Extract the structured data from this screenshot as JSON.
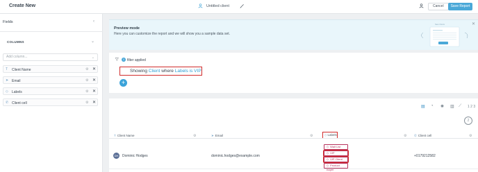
{
  "topbar": {
    "title": "Create New",
    "client_icon": "person-icon",
    "client_name": "Untitled client",
    "cancel_label": "Cancel",
    "save_label": "Save Report"
  },
  "sidebar": {
    "header": "Fields",
    "columns_label": "COLUMNS",
    "add_placeholder": "Add column...",
    "items": [
      {
        "label": "Client Name",
        "icon": "text-icon"
      },
      {
        "label": "Email",
        "icon": "send-icon"
      },
      {
        "label": "Labels",
        "icon": "tag-icon"
      },
      {
        "label": "Client cell",
        "icon": "phone-icon"
      }
    ]
  },
  "preview": {
    "title": "Preview mode",
    "description": "Here you can customize the report and we will show you a sample data set.",
    "illustration_text": "Save Clients"
  },
  "filter": {
    "count": "1",
    "label": "filter applied",
    "sentence": {
      "prefix": "Showing",
      "field": "Client",
      "mid": "where",
      "condition": "Labels is VIP"
    },
    "add_label": "+"
  },
  "table": {
    "page_counter": "1 2 3",
    "chart_toggle": "2",
    "headers": [
      "Client Name",
      "Email",
      "Labels",
      "Client cell"
    ],
    "rows": [
      {
        "initials": "DH",
        "name": "Dominic Hodges",
        "email": "dominic.hodges@example.com",
        "labels": [
          "Wait List",
          "VIP",
          "VIP Client",
          "Product Buyer"
        ],
        "cell": "+0179212582"
      }
    ]
  },
  "colors": {
    "accent": "#4aa8d8",
    "highlight_box": "#d02b2b",
    "tag": "#b7305c",
    "preview_bg": "#e9f6fb"
  }
}
